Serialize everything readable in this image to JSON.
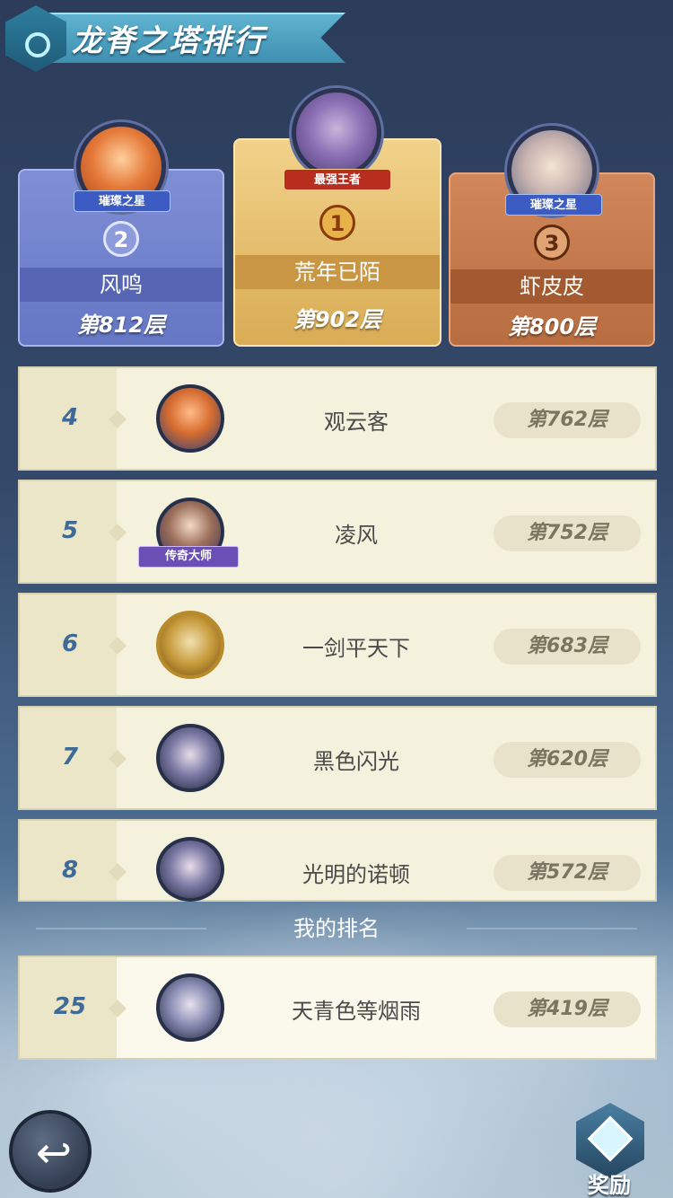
{
  "header": {
    "title": "龙脊之塔排行",
    "emblem_icon": "shield-eye-icon"
  },
  "podium": [
    {
      "rank": "2",
      "name": "风鸣",
      "floor": "第812层",
      "badge": "璀璨之星",
      "avatar_icon": "hero-avatar-icon"
    },
    {
      "rank": "1",
      "name": "荒年已陌",
      "floor": "第902层",
      "badge": "最强王者",
      "avatar_icon": "hero-avatar-icon"
    },
    {
      "rank": "3",
      "name": "虾皮皮",
      "floor": "第800层",
      "badge": "璀璨之星",
      "avatar_icon": "hero-avatar-icon"
    }
  ],
  "rankings": [
    {
      "rank": "4",
      "name": "观云客",
      "floor": "第762层",
      "badge": ""
    },
    {
      "rank": "5",
      "name": "凌风",
      "floor": "第752层",
      "badge": "传奇大师"
    },
    {
      "rank": "6",
      "name": "一剑平天下",
      "floor": "第683层",
      "badge": ""
    },
    {
      "rank": "7",
      "name": "黑色闪光",
      "floor": "第620层",
      "badge": ""
    },
    {
      "rank": "8",
      "name": "光明的诺顿",
      "floor": "第572层",
      "badge": ""
    }
  ],
  "my_rank": {
    "section_label": "我的排名",
    "rank": "25",
    "name": "天青色等烟雨",
    "floor": "第419层"
  },
  "footer": {
    "back_icon": "back-arrow-icon",
    "reward_label": "奖励",
    "reward_icon": "crown-diamond-icon"
  },
  "colors": {
    "gold": "#d9ac55",
    "silver_blue": "#6577c4",
    "bronze": "#b86d40",
    "row_bg": "#f4f1dc",
    "rank_number": "#3d6a96"
  }
}
